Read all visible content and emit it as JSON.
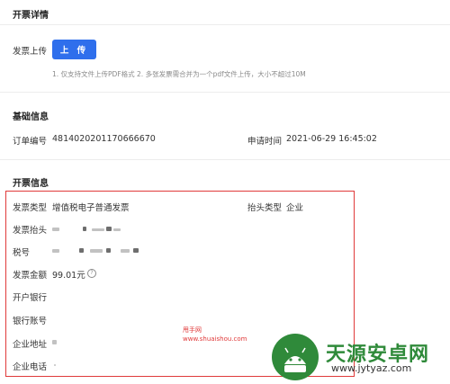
{
  "invoice_detail": {
    "title": "开票详情",
    "upload_label": "发票上传",
    "upload_button": "上 传",
    "hint": "1. 仅支持文件上传PDF格式 2. 多张发票需合并为一个pdf文件上传，大小不超过10M"
  },
  "basic_info": {
    "title": "基础信息",
    "order_no_label": "订单编号",
    "order_no": "4814020201170666670",
    "apply_time_label": "申请时间",
    "apply_time": "2021-06-29 16:45:02"
  },
  "invoice_info": {
    "title": "开票信息",
    "type_label": "发票类型",
    "type_value": "增值税电子普通发票",
    "header_type_label": "抬头类型",
    "header_type_value": "企业",
    "header_label": "发票抬头",
    "tax_no_label": "税号",
    "amount_label": "发票金额",
    "amount_value": "99.01元",
    "bank_label": "开户银行",
    "account_label": "银行账号",
    "address_label": "企业地址",
    "phone_label": "企业电话"
  },
  "watermarks": {
    "small_site": "甩手网",
    "small_url": "www.shuaishou.com",
    "big_site": "天源安卓网",
    "big_url": "www.jytyaz.com"
  },
  "colors": {
    "accent": "#2f6fec",
    "highlight": "#e03a3a",
    "logo_green": "#2f8a3a"
  }
}
